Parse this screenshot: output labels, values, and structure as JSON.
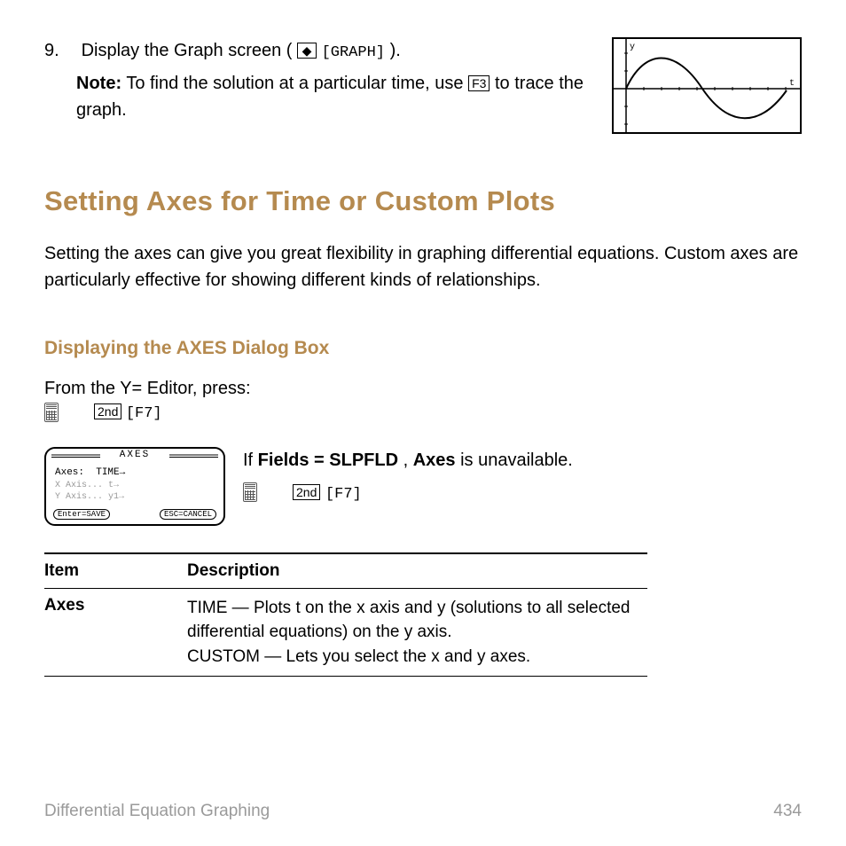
{
  "step9": {
    "number": "9.",
    "text_a": "Display the Graph screen (",
    "diamond": "◆",
    "graph_label": "GRAPH",
    "text_b": ").",
    "note_label": "Note:",
    "note_a": " To find the solution at a particular time, use ",
    "f3": "F3",
    "note_b": " to trace the graph."
  },
  "graph_labels": {
    "y": "y",
    "t": "t"
  },
  "h1": "Setting Axes for Time or Custom Plots",
  "intro": "Setting the axes can give you great flexibility in graphing differential equations. Custom axes are particularly effective for showing different kinds of relationships.",
  "h2": "Displaying the AXES Dialog Box",
  "from_line": "From the Y= Editor, press:",
  "keys": {
    "second": "2nd",
    "f7": "F7"
  },
  "axes_dialog": {
    "title": "AXES",
    "row1_label": "Axes:",
    "row1_value": "TIME→",
    "dim1": "X Axis... t→",
    "dim2": "Y Axis... y1→",
    "btn_save": "Enter=SAVE",
    "btn_cancel": "ESC=CANCEL"
  },
  "right_text": {
    "a": "If ",
    "b": "Fields = SLPFLD",
    "c": ", ",
    "d": "Axes",
    "e": " is unavailable."
  },
  "table": {
    "h1": "Item",
    "h2": "Description",
    "row1_item": "Axes",
    "row1_desc_a": "TIME — Plots t on the x axis and y (solutions to all selected differential equations) on the y axis.",
    "row1_desc_b": "CUSTOM — Lets you select the x and y axes."
  },
  "footer": {
    "left": "Differential Equation Graphing",
    "right": "434"
  }
}
